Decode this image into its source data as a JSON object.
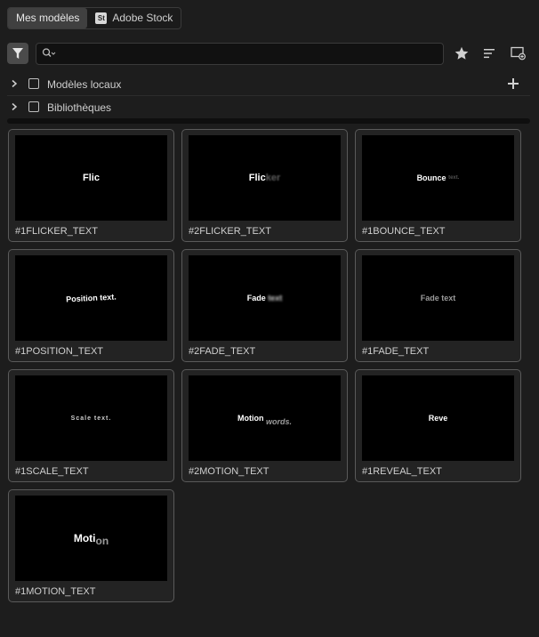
{
  "tabs": [
    {
      "label": "Mes modèles",
      "active": true
    },
    {
      "label": "Adobe Stock",
      "badge": "St",
      "active": false
    }
  ],
  "search": {
    "value": "",
    "placeholder": ""
  },
  "tree": [
    {
      "label": "Modèles locaux"
    },
    {
      "label": "Bibliothèques"
    }
  ],
  "templates": [
    {
      "name": "#1FLICKER_TEXT",
      "preview_a": "Flic",
      "preview_b": ""
    },
    {
      "name": "#2FLICKER_TEXT",
      "preview_a": "Flic",
      "preview_b": "ker"
    },
    {
      "name": "#1BOUNCE_TEXT",
      "preview_a": "Bounce",
      "preview_b": "text."
    },
    {
      "name": "#1POSITION_TEXT",
      "preview_a": "Position text.",
      "preview_b": ""
    },
    {
      "name": "#2FADE_TEXT",
      "preview_a": "Fade",
      "preview_b": "text"
    },
    {
      "name": "#1FADE_TEXT",
      "preview_a": "Fade text",
      "preview_b": ""
    },
    {
      "name": "#1SCALE_TEXT",
      "preview_a": "Scale text.",
      "preview_b": ""
    },
    {
      "name": "#2MOTION_TEXT",
      "preview_a": "Motion",
      "preview_b": "words."
    },
    {
      "name": "#1REVEAL_TEXT",
      "preview_a": "Reve",
      "preview_b": ""
    },
    {
      "name": "#1MOTION_TEXT",
      "preview_a": "Moti",
      "preview_b": "on"
    }
  ],
  "colors": {
    "background": "#1d1d1d",
    "card_border": "#5a5a5a",
    "tab_active": "#404040"
  },
  "icons": [
    "filter-icon",
    "search-icon",
    "star-icon",
    "sort-icon",
    "new-template-icon",
    "plus-icon",
    "chevron-right-icon"
  ]
}
